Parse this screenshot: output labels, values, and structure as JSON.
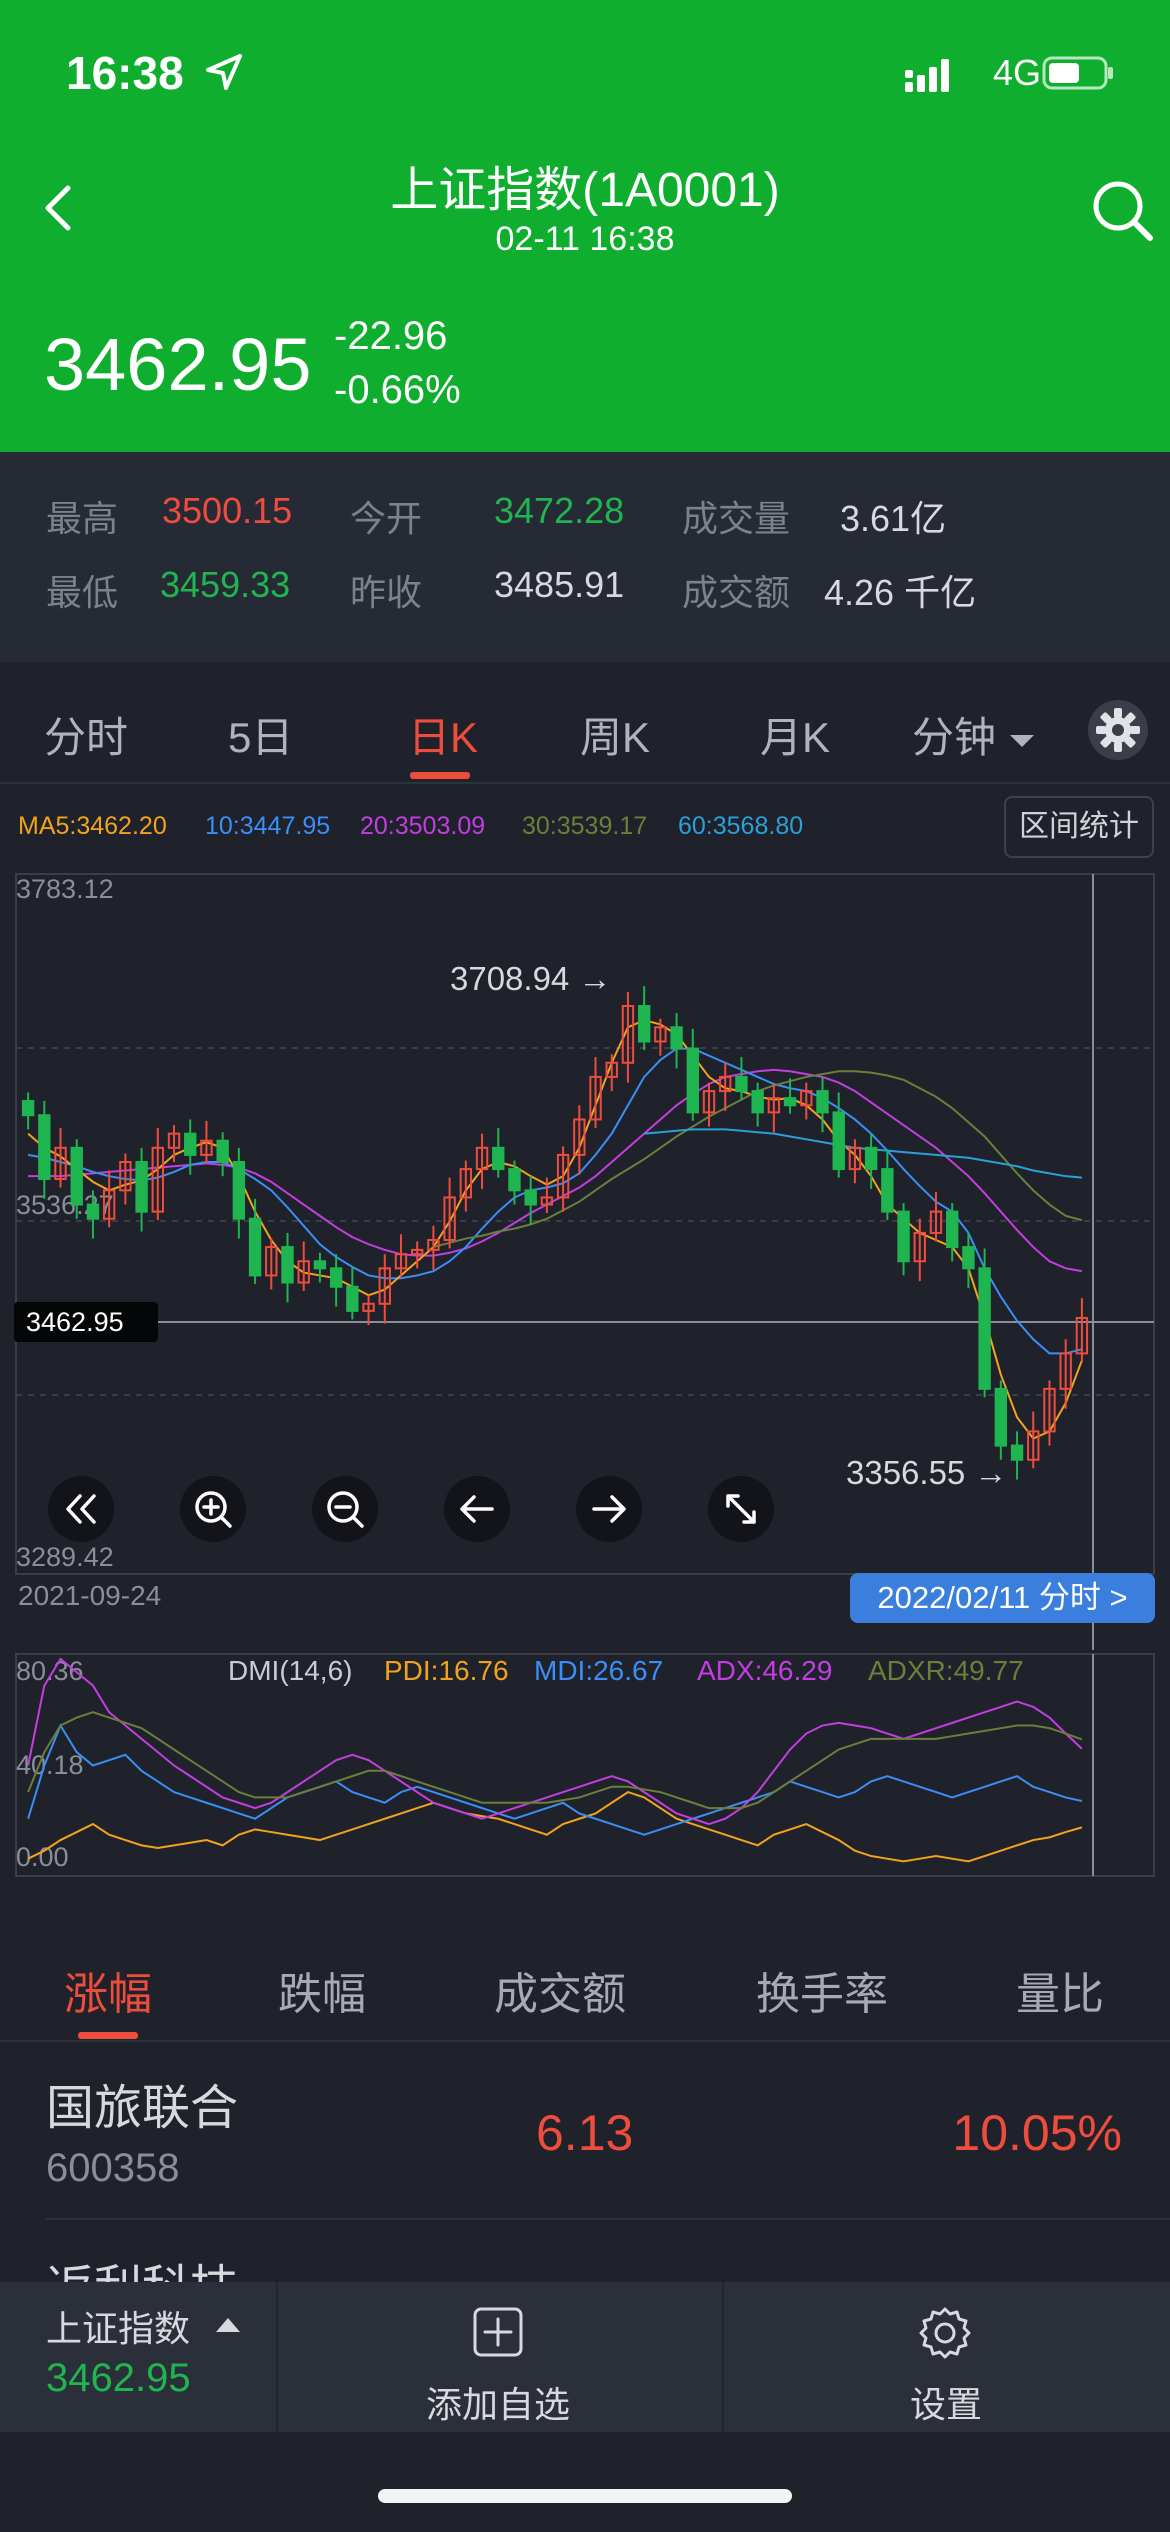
{
  "status_bar": {
    "time": "16:38",
    "network": "4G"
  },
  "header": {
    "title": "上证指数(1A0001)",
    "subtitle": "02-11 16:38",
    "price": "3462.95",
    "change": "-22.96",
    "change_pct": "-0.66%"
  },
  "stats": {
    "high_label": "最高",
    "high": "3500.15",
    "open_label": "今开",
    "open": "3472.28",
    "volume_label": "成交量",
    "volume": "3.61亿",
    "low_label": "最低",
    "low": "3459.33",
    "prev_close_label": "昨收",
    "prev_close": "3485.91",
    "amount_label": "成交额",
    "amount": "4.26 千亿"
  },
  "period_tabs": [
    "分时",
    "5日",
    "日K",
    "周K",
    "月K",
    "分钟"
  ],
  "active_period": "日K",
  "chart_data": [
    {
      "type": "candlestick",
      "ma_legend": {
        "ma5": "MA5:3462.20",
        "ma10": "10:3447.95",
        "ma20": "20:3503.09",
        "ma30": "30:3539.17",
        "ma60": "60:3568.80"
      },
      "y_ticks": [
        "3783.12",
        "3536.27",
        "3289.42"
      ],
      "ylim": [
        3289.42,
        3783.12
      ],
      "crosshair_value": "3462.95",
      "high_marker": "3708.94 →",
      "low_marker": "3356.55 →",
      "start_date": "2021-09-24",
      "end_date_chip": "2022/02/11 分时 >",
      "close": [
        3613,
        3568,
        3590,
        3550,
        3540,
        3560,
        3580,
        3545,
        3590,
        3600,
        3585,
        3595,
        3580,
        3540,
        3500,
        3520,
        3495,
        3510,
        3505,
        3492,
        3475,
        3480,
        3505,
        3515,
        3518,
        3525,
        3555,
        3575,
        3590,
        3575,
        3560,
        3550,
        3555,
        3585,
        3610,
        3640,
        3650,
        3690,
        3665,
        3675,
        3660,
        3615,
        3630,
        3640,
        3630,
        3615,
        3625,
        3620,
        3630,
        3615,
        3575,
        3590,
        3575,
        3545,
        3510,
        3530,
        3545,
        3520,
        3505,
        3420,
        3380,
        3370,
        3390,
        3420,
        3445,
        3470
      ],
      "ma_series": {
        "ma5": [
          3600,
          3590,
          3584,
          3575,
          3566,
          3560,
          3564,
          3567,
          3575,
          3585,
          3590,
          3594,
          3590,
          3570,
          3545,
          3525,
          3510,
          3502,
          3500,
          3498,
          3492,
          3486,
          3490,
          3500,
          3510,
          3520,
          3538,
          3560,
          3575,
          3580,
          3577,
          3570,
          3564,
          3570,
          3590,
          3620,
          3650,
          3675,
          3680,
          3677,
          3670,
          3655,
          3640,
          3632,
          3630,
          3626,
          3624,
          3625,
          3620,
          3610,
          3595,
          3585,
          3570,
          3550,
          3540,
          3530,
          3525,
          3520,
          3505,
          3470,
          3430,
          3400,
          3385,
          3390,
          3410,
          3440
        ],
        "ma10": [
          3585,
          3583,
          3580,
          3577,
          3573,
          3570,
          3568,
          3567,
          3569,
          3573,
          3578,
          3580,
          3580,
          3575,
          3568,
          3560,
          3548,
          3535,
          3522,
          3513,
          3506,
          3500,
          3498,
          3498,
          3500,
          3503,
          3510,
          3520,
          3533,
          3545,
          3555,
          3560,
          3562,
          3565,
          3572,
          3585,
          3600,
          3620,
          3640,
          3652,
          3660,
          3660,
          3655,
          3650,
          3645,
          3640,
          3635,
          3632,
          3630,
          3625,
          3618,
          3610,
          3600,
          3588,
          3575,
          3563,
          3552,
          3545,
          3530,
          3505,
          3485,
          3468,
          3455,
          3445,
          3445,
          3448
        ],
        "ma20": [
          3570,
          3570,
          3570,
          3571,
          3572,
          3573,
          3574,
          3575,
          3576,
          3577,
          3578,
          3579,
          3578,
          3576,
          3572,
          3566,
          3558,
          3550,
          3542,
          3534,
          3527,
          3522,
          3518,
          3515,
          3514,
          3514,
          3516,
          3519,
          3524,
          3530,
          3537,
          3544,
          3550,
          3556,
          3562,
          3570,
          3580,
          3590,
          3600,
          3610,
          3620,
          3628,
          3635,
          3640,
          3642,
          3644,
          3645,
          3644,
          3642,
          3640,
          3636,
          3630,
          3622,
          3614,
          3606,
          3598,
          3590,
          3580,
          3570,
          3558,
          3545,
          3532,
          3520,
          3510,
          3505,
          3503
        ]
      },
      "ma30_series": [
        3520,
        3523,
        3526,
        3528,
        3531,
        3533,
        3536,
        3540,
        3546,
        3552,
        3560,
        3568,
        3575,
        3582,
        3590,
        3598,
        3605,
        3612,
        3618,
        3624,
        3630,
        3634,
        3637,
        3640,
        3642,
        3644,
        3644,
        3643,
        3641,
        3638,
        3632,
        3626,
        3618,
        3608,
        3598,
        3585,
        3572,
        3560,
        3550,
        3542,
        3539
      ],
      "ma60_series": [
        3600,
        3601,
        3602,
        3603,
        3603,
        3603,
        3602,
        3601,
        3600,
        3598,
        3596,
        3594,
        3592,
        3590,
        3589,
        3588,
        3587,
        3586,
        3585,
        3584,
        3583,
        3581,
        3579,
        3577,
        3574,
        3572,
        3570,
        3569
      ]
    },
    {
      "type": "line",
      "indicator": "DMI(14,6)",
      "legend": {
        "pdi": "PDI:16.76",
        "mdi": "MDI:26.67",
        "adx": "ADX:46.29",
        "adxr": "ADXR:49.77"
      },
      "y_ticks": [
        "80.36",
        "40.18",
        "0.00"
      ],
      "ylim": [
        0,
        80.36
      ],
      "series": [
        {
          "name": "PDI",
          "values": [
            5,
            8,
            12,
            15,
            18,
            14,
            12,
            10,
            9,
            10,
            11,
            12,
            10,
            14,
            16,
            15,
            14,
            13,
            12,
            14,
            16,
            18,
            20,
            22,
            24,
            26,
            24,
            22,
            21,
            20,
            18,
            16,
            14,
            18,
            20,
            22,
            26,
            30,
            28,
            24,
            20,
            18,
            16,
            14,
            12,
            10,
            14,
            16,
            18,
            15,
            12,
            8,
            6,
            5,
            4,
            5,
            6,
            5,
            4,
            6,
            8,
            10,
            12,
            13,
            15,
            16.76
          ]
        },
        {
          "name": "MDI",
          "values": [
            20,
            40,
            55,
            45,
            40,
            42,
            44,
            38,
            34,
            30,
            28,
            26,
            24,
            22,
            20,
            24,
            28,
            30,
            32,
            34,
            30,
            28,
            26,
            30,
            32,
            30,
            28,
            26,
            24,
            22,
            20,
            22,
            24,
            26,
            22,
            20,
            18,
            16,
            14,
            16,
            18,
            20,
            22,
            24,
            26,
            28,
            30,
            34,
            32,
            30,
            28,
            30,
            34,
            36,
            34,
            32,
            30,
            28,
            30,
            32,
            34,
            36,
            32,
            30,
            28,
            26.67
          ]
        },
        {
          "name": "ADX",
          "values": [
            40,
            70,
            80,
            75,
            70,
            60,
            55,
            50,
            45,
            40,
            36,
            32,
            28,
            26,
            24,
            26,
            30,
            34,
            38,
            42,
            44,
            42,
            38,
            34,
            30,
            26,
            24,
            22,
            20,
            22,
            24,
            26,
            28,
            30,
            32,
            34,
            36,
            34,
            30,
            26,
            22,
            20,
            18,
            20,
            24,
            30,
            38,
            46,
            52,
            55,
            56,
            55,
            54,
            52,
            50,
            52,
            54,
            56,
            58,
            60,
            62,
            64,
            62,
            58,
            52,
            46.29
          ]
        },
        {
          "name": "ADXR",
          "values": [
            30,
            45,
            55,
            58,
            60,
            58,
            56,
            54,
            50,
            46,
            42,
            38,
            34,
            30,
            28,
            28,
            28,
            30,
            32,
            34,
            36,
            38,
            38,
            36,
            34,
            32,
            30,
            28,
            26,
            26,
            26,
            26,
            26,
            27,
            28,
            30,
            32,
            32,
            31,
            30,
            28,
            26,
            24,
            24,
            24,
            26,
            30,
            34,
            38,
            42,
            46,
            48,
            50,
            50,
            50,
            50,
            50,
            51,
            52,
            53,
            54,
            55,
            55,
            54,
            52,
            49.77
          ]
        }
      ]
    }
  ],
  "rank_tabs": [
    "涨幅",
    "跌幅",
    "成交额",
    "换手率",
    "量比"
  ],
  "active_rank": "涨幅",
  "rank_rows": [
    {
      "name": "国旅联合",
      "code": "600358",
      "price": "6.13",
      "pct": "10.05%"
    },
    {
      "name": "返利科技"
    }
  ],
  "range_button": "区间统计",
  "bottom_bar": {
    "index_name": "上证指数",
    "index_price": "3462.95",
    "add_label": "添加自选",
    "settings_label": "设置"
  },
  "colors": {
    "header_green": "#0fae2e",
    "up_red": "#ee4d3d",
    "down_green": "#1fb550",
    "ma5": "#f2a31d",
    "ma10": "#3a8ef6",
    "ma20": "#c33ee0",
    "ma30": "#6a7f3a",
    "ma60": "#2aa0d8"
  }
}
